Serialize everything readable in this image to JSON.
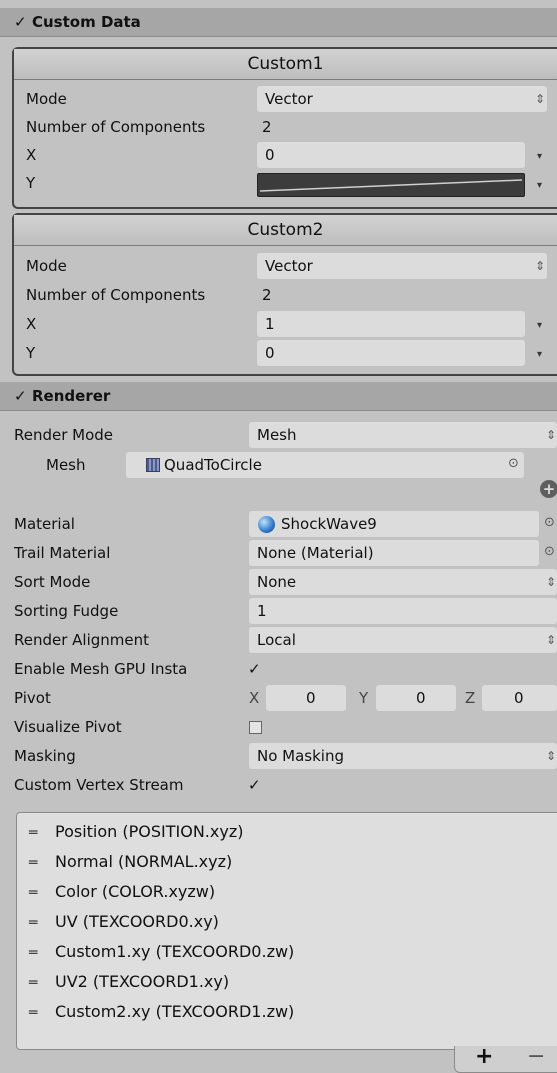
{
  "custom_data": {
    "title": "Custom Data",
    "custom1": {
      "title": "Custom1",
      "mode_label": "Mode",
      "mode_value": "Vector",
      "num_label": "Number of Components",
      "num_value": "2",
      "x_label": "X",
      "x_value": "0",
      "y_label": "Y"
    },
    "custom2": {
      "title": "Custom2",
      "mode_label": "Mode",
      "mode_value": "Vector",
      "num_label": "Number of Components",
      "num_value": "2",
      "x_label": "X",
      "x_value": "1",
      "y_label": "Y",
      "y_value": "0"
    }
  },
  "renderer": {
    "title": "Renderer",
    "render_mode_label": "Render Mode",
    "render_mode_value": "Mesh",
    "mesh_label": "Mesh",
    "mesh_value": "QuadToCircle",
    "material_label": "Material",
    "material_value": "ShockWave9",
    "trail_label": "Trail Material",
    "trail_value": "None (Material)",
    "sort_label": "Sort Mode",
    "sort_value": "None",
    "fudge_label": "Sorting Fudge",
    "fudge_value": "1",
    "align_label": "Render Alignment",
    "align_value": "Local",
    "gpu_label": "Enable Mesh GPU Insta",
    "pivot_label": "Pivot",
    "pivot_x_label": "X",
    "pivot_x": "0",
    "pivot_y_label": "Y",
    "pivot_y": "0",
    "pivot_z_label": "Z",
    "pivot_z": "0",
    "vis_pivot_label": "Visualize Pivot",
    "masking_label": "Masking",
    "masking_value": "No Masking",
    "streams_label": "Custom Vertex Stream",
    "streams": [
      "Position (POSITION.xyz)",
      "Normal (NORMAL.xyz)",
      "Color (COLOR.xyzw)",
      "UV (TEXCOORD0.xy)",
      "Custom1.xy (TEXCOORD0.zw)",
      "UV2 (TEXCOORD1.xy)",
      "Custom2.xy (TEXCOORD1.zw)"
    ],
    "add_label": "+",
    "remove_label": "−"
  },
  "icons": {
    "check": "✓",
    "updown": "⇕",
    "dropdown": "▾",
    "object_picker": "⊙",
    "drag_handle": "═"
  }
}
